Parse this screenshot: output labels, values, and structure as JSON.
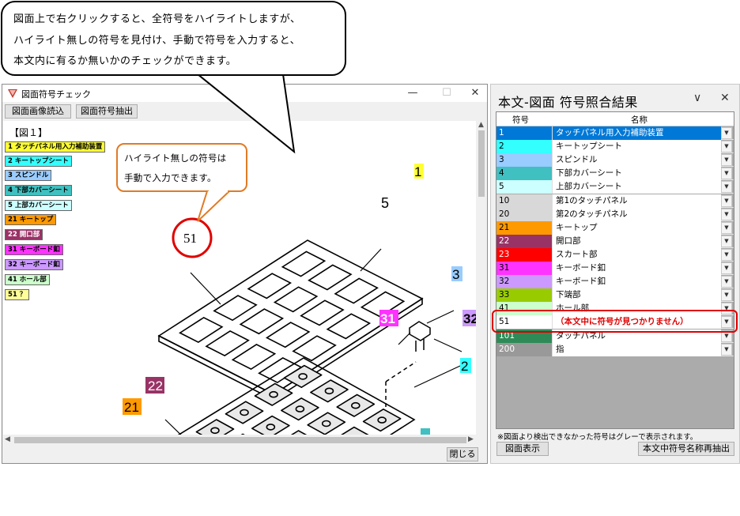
{
  "callout": {
    "lines": [
      "図面上で右クリックすると、全符号をハイライトしますが、",
      "ハイライト無しの符号を見付け、手動で符号を入力すると、",
      "本文内に有るか無いかのチェックができます。"
    ]
  },
  "left_window": {
    "title": "図面符号チェック",
    "btn_load": "図面画像読込",
    "btn_extract": "図面符号抽出",
    "btn_close": "閉じる",
    "fig_label": "【図１】",
    "win_min": "—",
    "win_max": "☐",
    "win_close": "✕",
    "legend": [
      {
        "text": "1 タッチパネル用入力補助装置",
        "color": "#ffff33"
      },
      {
        "text": "2 キートップシート",
        "color": "#33ffff"
      },
      {
        "text": "3 スピンドル",
        "color": "#99ccff"
      },
      {
        "text": "4 下部カバーシート",
        "color": "#40c0c0"
      },
      {
        "text": "5 上部カバーシート",
        "color": "#ccffff"
      },
      {
        "text": "21 キートップ",
        "color": "#ff9900"
      },
      {
        "text": "22 開口部",
        "color": "#993366"
      },
      {
        "text": "31 キーボード釦",
        "color": "#ff33ff"
      },
      {
        "text": "32 キーボード釦",
        "color": "#cc99ff"
      },
      {
        "text": "41 ホール部",
        "color": "#ccffcc"
      },
      {
        "text": "51 ？",
        "color": "#ffff99"
      }
    ],
    "callout_small": [
      "ハイライト無しの符号は",
      "手動で入力できます。"
    ],
    "drawing_labels": {
      "l1": "1",
      "l5": "5",
      "l3": "3",
      "l31": "31",
      "l32": "32",
      "l2": "2",
      "l22": "22",
      "l21": "21",
      "l51": "51"
    }
  },
  "right_panel": {
    "title": "本文-図面 符号照合結果",
    "chevron": "∨",
    "close": "✕",
    "col_code": "符号",
    "col_name": "名称",
    "rows": [
      {
        "code": "1",
        "name": "タッチパネル用入力補助装置",
        "color": "#0078d7",
        "selected": true
      },
      {
        "code": "2",
        "name": "キートップシート",
        "color": "#33ffff"
      },
      {
        "code": "3",
        "name": "スピンドル",
        "color": "#99ccff"
      },
      {
        "code": "4",
        "name": "下部カバーシート",
        "color": "#40c0c0"
      },
      {
        "code": "5",
        "name": "上部カバーシート",
        "color": "#ccffff"
      },
      {
        "code": "10",
        "name": "第1のタッチパネル",
        "color": "#d8d8d8"
      },
      {
        "code": "20",
        "name": "第2のタッチパネル",
        "color": "#d8d8d8"
      },
      {
        "code": "21",
        "name": "キートップ",
        "color": "#ff9900"
      },
      {
        "code": "22",
        "name": "開口部",
        "color": "#993366"
      },
      {
        "code": "23",
        "name": "スカート部",
        "color": "#ff0000"
      },
      {
        "code": "31",
        "name": "キーボード釦",
        "color": "#ff33ff"
      },
      {
        "code": "32",
        "name": "キーボード釦",
        "color": "#cc99ff"
      },
      {
        "code": "33",
        "name": "下端部",
        "color": "#99cc00"
      },
      {
        "code": "41",
        "name": "ホール部",
        "color": "#ccffcc"
      },
      {
        "code": "51",
        "name": "（本文中に符号が見つかりません）",
        "color": "#ffffff",
        "missing": true
      },
      {
        "code": "101",
        "name": "タッチパネル",
        "color": "#2e8b57"
      },
      {
        "code": "200",
        "name": "指",
        "color": "#999999"
      }
    ],
    "note": "※図面より検出できなかった符号はグレーで表示されます。",
    "btn_show": "図面表示",
    "btn_reextract": "本文中符号名称再抽出"
  }
}
